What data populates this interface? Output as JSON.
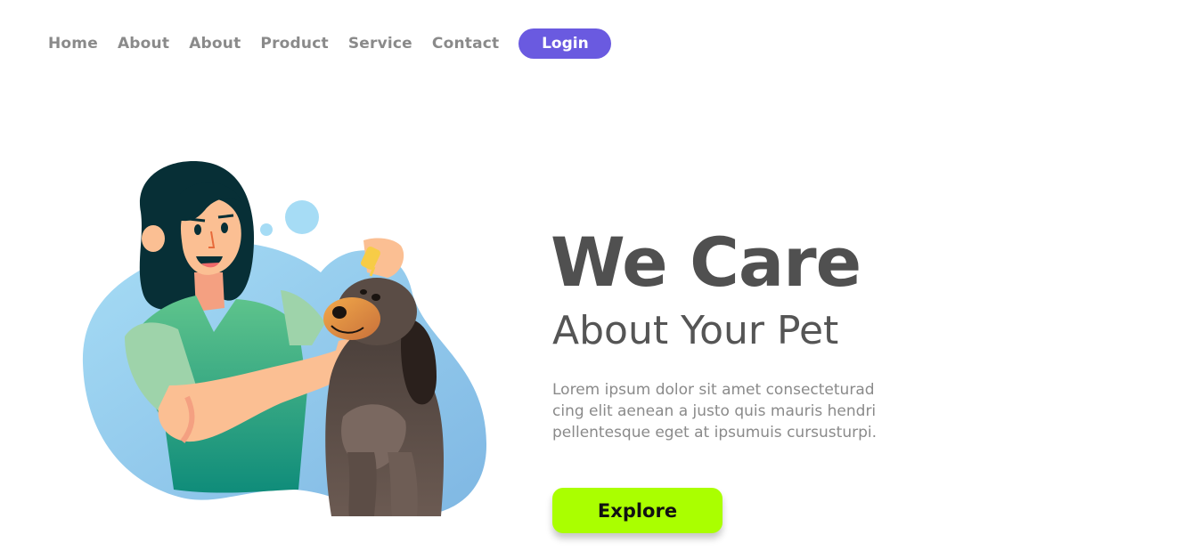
{
  "nav": {
    "links": [
      {
        "label": "Home"
      },
      {
        "label": "About"
      },
      {
        "label": "About"
      },
      {
        "label": "Product"
      },
      {
        "label": "Service"
      },
      {
        "label": "Contact"
      }
    ],
    "login_label": "Login"
  },
  "hero": {
    "title": "We Care",
    "subtitle": "About Your Pet",
    "description_lines": [
      "Lorem ipsum dolor sit amet consecteturad",
      "cing elit aenean a justo quis mauris hendri",
      "pellentesque eget at ipsumuis cursusturpi."
    ],
    "cta_label": "Explore"
  },
  "illustration": {
    "icon": "woman-giving-dog-eye-drops-illustration"
  },
  "colors": {
    "login_bg": "#6a5ae0",
    "cta_bg": "#aaff00",
    "title": "#505050",
    "nav_text": "#8a8a8a",
    "blob": "#8cc5ec"
  }
}
